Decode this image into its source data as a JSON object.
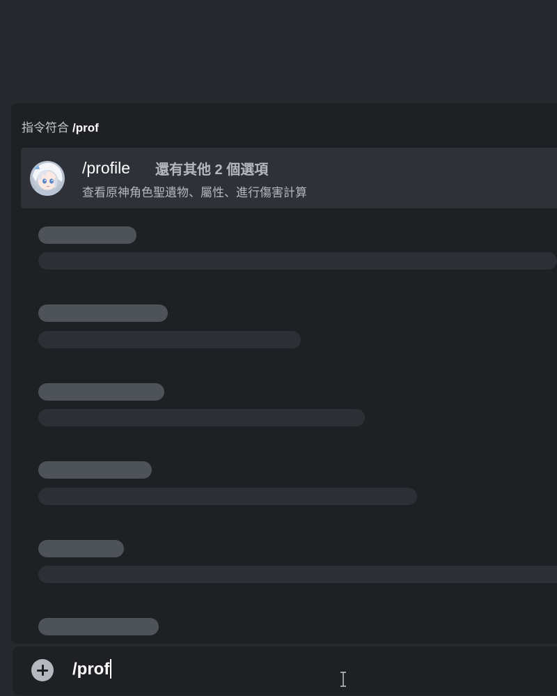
{
  "autocomplete": {
    "header_label": "指令符合",
    "query": "/prof",
    "options": [
      {
        "name": "/profile",
        "more_label": "還有其他 2 個選項",
        "description": "查看原神角色聖遺物、屬性、進行傷害計算",
        "avatar_icon": "anime-character-avatar-icon"
      }
    ]
  },
  "composer": {
    "value": "/prof",
    "attach_icon": "plus-circle-icon"
  },
  "colors": {
    "background": "#25282c",
    "panel": "#1e2024",
    "selected_option": "#2e3137",
    "skeleton_title": "#4e5259",
    "skeleton_line": "#2c2f35",
    "text_primary": "#ffffff",
    "text_secondary": "#b5b8be"
  }
}
